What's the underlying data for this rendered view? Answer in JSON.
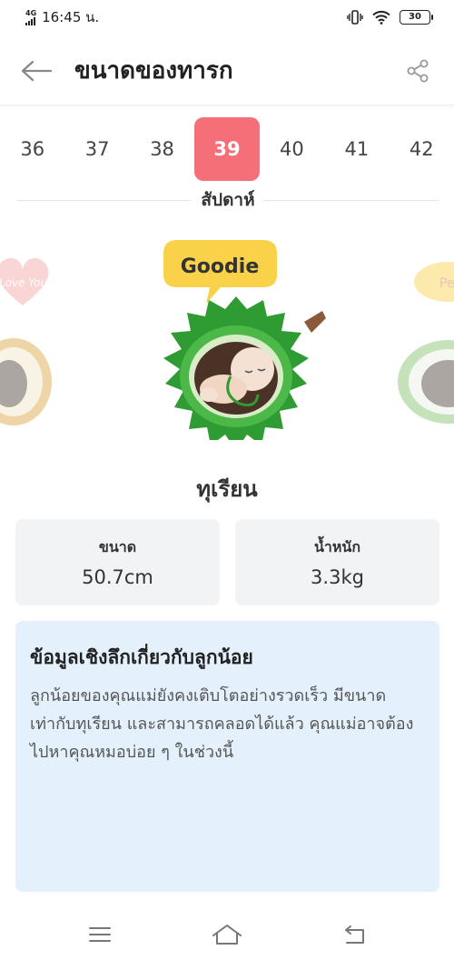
{
  "status_bar": {
    "network": "4G",
    "time": "16:45 น.",
    "battery": "30"
  },
  "header": {
    "title": "ขนาดของทารก"
  },
  "weeks": {
    "items": [
      "36",
      "37",
      "38",
      "39",
      "40",
      "41",
      "42"
    ],
    "selected": "39",
    "label": "สัปดาห์"
  },
  "hero": {
    "speech_bubble": "Goodie",
    "left_bubble": "Love You!",
    "right_bubble": "Pe",
    "colors": {
      "speech_bubble": "#f9d24a",
      "durian": "#3aa83a",
      "left_bubble": "#f3a4a4"
    }
  },
  "fruit": {
    "name": "ทุเรียน"
  },
  "stats": {
    "size_label": "ขนาด",
    "size_value": "50.7cm",
    "weight_label": "น้ำหนัก",
    "weight_value": "3.3kg"
  },
  "info": {
    "title": "ข้อมูลเชิงลึกเกี่ยวกับลูกน้อย",
    "body": "ลูกน้อยของคุณแม่ยังคงเติบโตอย่างรวดเร็ว มีขนาดเท่ากับทุเรียน และสามารถคลอดได้แล้ว คุณแม่อาจต้องไปหาคุณหมอบ่อย ๆ ในช่วงนี้"
  },
  "colors": {
    "accent": "#f46f78",
    "info_bg": "#e4f1fc",
    "stat_bg": "#f2f3f5"
  },
  "icons": {
    "back": "back-arrow-icon",
    "share": "share-icon",
    "menu": "menu-icon",
    "home": "home-icon",
    "return": "return-icon"
  }
}
